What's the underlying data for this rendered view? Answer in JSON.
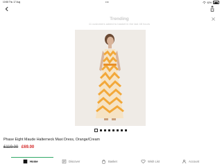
{
  "status_bar": {
    "time": "10:58",
    "date": "Thu 17 Aug",
    "multitask_dots": "•••",
    "battery_percent": "62%"
  },
  "banner": {
    "title": "Trending",
    "subtitle": "11 customers added to basket in the last 48 hours"
  },
  "gallery": {
    "total_images": 8,
    "active_index": 0
  },
  "product": {
    "name": "Phase Eight Maude Halterneck Maxi Dress, Orange/Cream",
    "price_old": "£119.00",
    "price_new": "£69.00"
  },
  "nav": {
    "items": [
      {
        "label": "Home",
        "icon": "home-icon"
      },
      {
        "label": "Discover",
        "icon": "discover-icon"
      },
      {
        "label": "Basket",
        "icon": "basket-icon"
      },
      {
        "label": "Wish List",
        "icon": "heart-icon"
      },
      {
        "label": "Account",
        "icon": "account-icon"
      }
    ],
    "active": "Home"
  },
  "colors": {
    "accent_green": "#2fa866",
    "sale_red": "#d21f1f",
    "dress_orange": "#f2a83a"
  }
}
